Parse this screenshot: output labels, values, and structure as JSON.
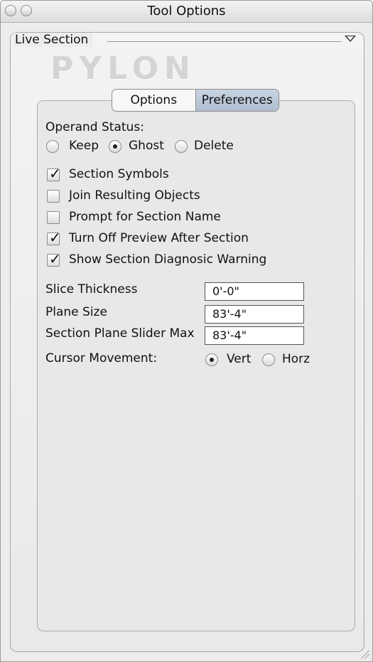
{
  "window": {
    "title": "Tool Options"
  },
  "section": {
    "label": "Live Section"
  },
  "logo": {
    "text": "PYLON"
  },
  "tabs": [
    {
      "label": "Options",
      "active": false
    },
    {
      "label": "Preferences",
      "active": true
    }
  ],
  "operand": {
    "label": "Operand Status:",
    "options": [
      {
        "label": "Keep",
        "selected": false
      },
      {
        "label": "Ghost",
        "selected": true
      },
      {
        "label": "Delete",
        "selected": false
      }
    ]
  },
  "checkboxes": [
    {
      "label": "Section Symbols",
      "checked": true
    },
    {
      "label": "Join Resulting Objects",
      "checked": false
    },
    {
      "label": "Prompt for Section Name",
      "checked": false
    },
    {
      "label": "Turn Off Preview After Section",
      "checked": true
    },
    {
      "label": "Show Section Diagnosic Warning",
      "checked": true
    }
  ],
  "fields": [
    {
      "label": "Slice Thickness",
      "value": "0'-0\""
    },
    {
      "label": "Plane Size",
      "value": "83'-4\""
    },
    {
      "label": "Section Plane Slider Max",
      "value": "83'-4\""
    }
  ],
  "cursor": {
    "label": "Cursor Movement:",
    "options": [
      {
        "label": "Vert",
        "selected": true
      },
      {
        "label": "Horz",
        "selected": false
      }
    ]
  }
}
